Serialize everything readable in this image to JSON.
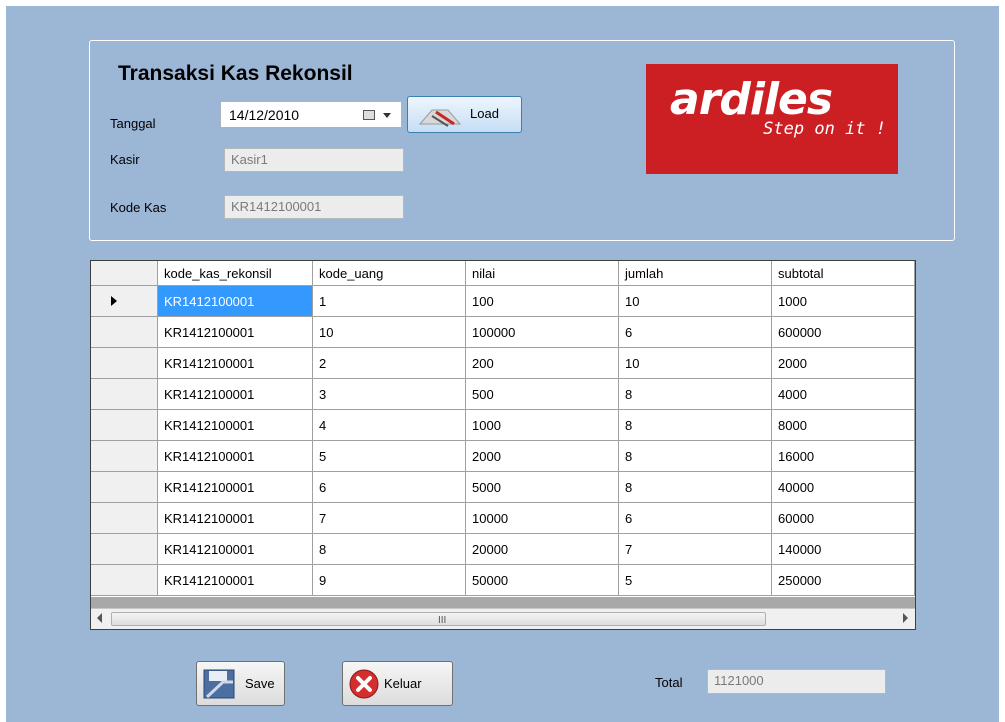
{
  "form": {
    "title": "Transaksi Kas Rekonsil",
    "tanggal_label": "Tanggal",
    "tanggal_value": "14/12/2010",
    "load_label": "Load",
    "kasir_label": "Kasir",
    "kasir_value": "Kasir1",
    "kode_kas_label": "Kode Kas",
    "kode_kas_value": "KR1412100001"
  },
  "logo": {
    "brand": "ardiles",
    "tagline": "Step on it !",
    "color": "#cc1f24"
  },
  "grid": {
    "columns": [
      "kode_kas_rekonsil",
      "kode_uang",
      "nilai",
      "jumlah",
      "subtotal"
    ],
    "rows": [
      [
        "KR1412100001",
        "1",
        "100",
        "10",
        "1000"
      ],
      [
        "KR1412100001",
        "10",
        "100000",
        "6",
        "600000"
      ],
      [
        "KR1412100001",
        "2",
        "200",
        "10",
        "2000"
      ],
      [
        "KR1412100001",
        "3",
        "500",
        "8",
        "4000"
      ],
      [
        "KR1412100001",
        "4",
        "1000",
        "8",
        "8000"
      ],
      [
        "KR1412100001",
        "5",
        "2000",
        "8",
        "16000"
      ],
      [
        "KR1412100001",
        "6",
        "5000",
        "8",
        "40000"
      ],
      [
        "KR1412100001",
        "7",
        "10000",
        "6",
        "60000"
      ],
      [
        "KR1412100001",
        "8",
        "20000",
        "7",
        "140000"
      ],
      [
        "KR1412100001",
        "9",
        "50000",
        "5",
        "250000"
      ]
    ],
    "selected_row": 0,
    "scroll_grip": "III"
  },
  "footer": {
    "save_label": "Save",
    "keluar_label": "Keluar",
    "total_label": "Total",
    "total_value": "1121000"
  },
  "colors": {
    "form_bg": "#9cb6d6",
    "selection": "#3399ff"
  }
}
